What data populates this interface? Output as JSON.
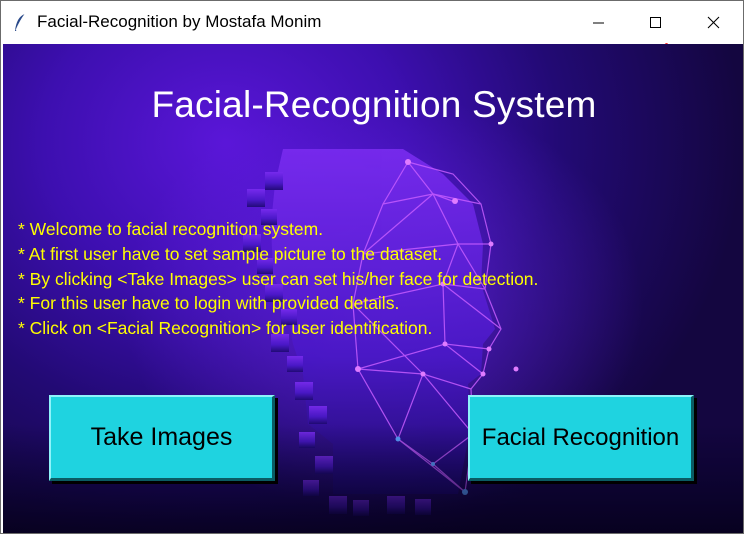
{
  "window": {
    "title": "Facial-Recognition by Mostafa Monim",
    "app_icon": "feather-icon",
    "controls": [
      "minimize-icon",
      "maximize-icon",
      "close-icon"
    ]
  },
  "main": {
    "heading": "Facial-Recognition System",
    "instructions": [
      "* Welcome to facial recognition system.",
      "* At first user have to set sample picture to the dataset.",
      "* By clicking <Take Images> user can set his/her face for detection.",
      "* For this user have to login with provided details.",
      "* Click on <Facial Recognition> for user identification."
    ],
    "buttons": {
      "take_images": "Take Images",
      "facial_recognition": "Facial Recognition"
    }
  },
  "colors": {
    "background_primary": "#3d0fb0",
    "background_dark": "#140640",
    "heading_text": "#ffffff",
    "instruction_text": "#ffff00",
    "button_bg": "#1fd3e0",
    "button_text": "#000000",
    "face_mesh_line": "#c060ff"
  }
}
